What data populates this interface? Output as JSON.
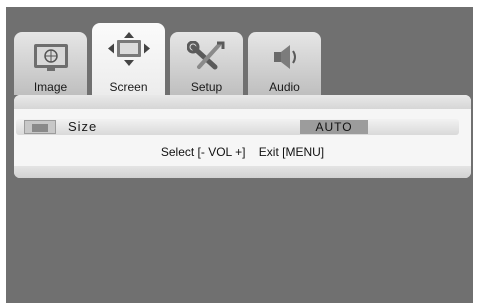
{
  "tabs": [
    {
      "label": "Image",
      "icon": "monitor-icon",
      "active": false
    },
    {
      "label": "Screen",
      "icon": "screen-move-icon",
      "active": true
    },
    {
      "label": "Setup",
      "icon": "tools-icon",
      "active": false
    },
    {
      "label": "Audio",
      "icon": "speaker-icon",
      "active": false
    }
  ],
  "menu": {
    "item_label": "Size",
    "item_icon": "aspect-icon",
    "item_value": "AUTO"
  },
  "hint": {
    "select": "Select [- VOL +]",
    "exit": "Exit [MENU]"
  },
  "colors": {
    "background": "#707070",
    "panel": "#f6f6f6",
    "value_box": "#9c9c9c"
  }
}
